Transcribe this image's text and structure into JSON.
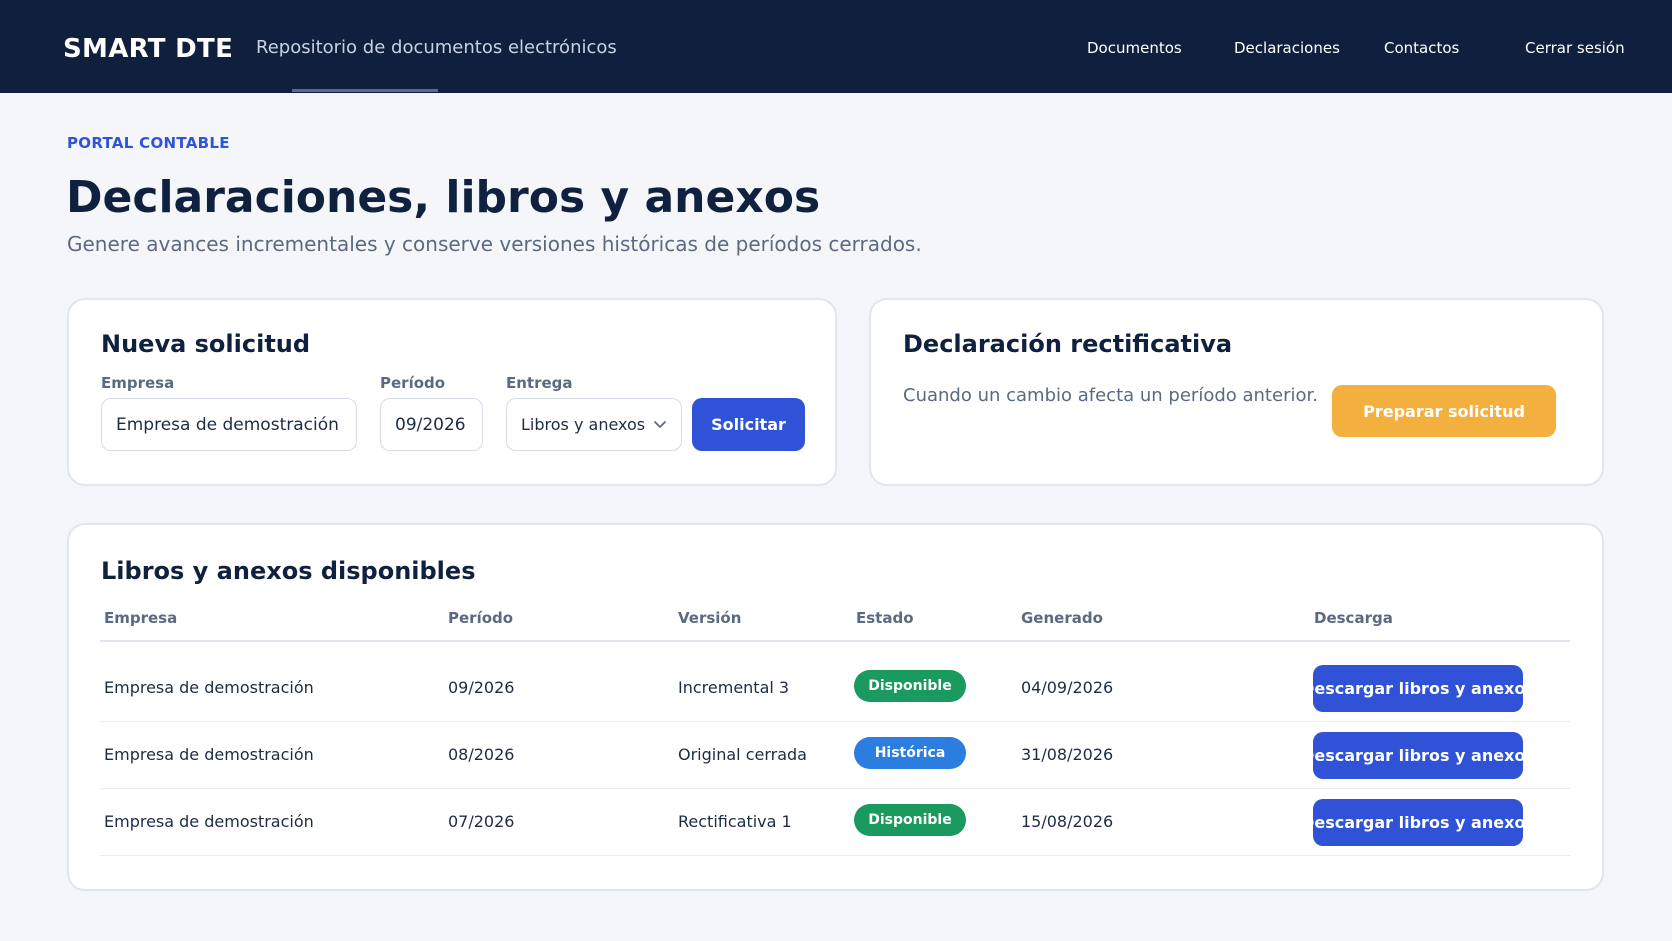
{
  "header": {
    "brand": "SMART DTE",
    "tagline": "Repositorio de documentos electrónicos",
    "nav": [
      "Documentos",
      "Declaraciones",
      "Contactos",
      "Cerrar sesión"
    ]
  },
  "page": {
    "eyebrow": "PORTAL CONTABLE",
    "title": "Declaraciones, libros y anexos",
    "subtitle": "Genere avances incrementales y conserve versiones históricas de períodos cerrados."
  },
  "new_request": {
    "title": "Nueva solicitud",
    "company_label": "Empresa",
    "company_value": "Empresa de demostración",
    "period_label": "Período",
    "period_value": "09/2026",
    "delivery_label": "Entrega",
    "delivery_value": "Libros y anexos",
    "submit_label": "Solicitar"
  },
  "rectification": {
    "title": "Declaración rectificativa",
    "description": "Cuando un cambio afecta un período anterior.",
    "button_label": "Preparar solicitud"
  },
  "table": {
    "title": "Libros y anexos disponibles",
    "headers": [
      "Empresa",
      "Período",
      "Versión",
      "Estado",
      "Generado",
      "Descarga"
    ],
    "rows": [
      {
        "company": "Empresa de demostración",
        "period": "09/2026",
        "version": "Incremental 3",
        "status": "Disponible",
        "generated": "04/09/2026",
        "download": "Descargar libros y anexos"
      },
      {
        "company": "Empresa de demostración",
        "period": "08/2026",
        "version": "Original cerrada",
        "status": "Histórica",
        "generated": "31/08/2026",
        "download": "Descargar libros y anexos"
      },
      {
        "company": "Empresa de demostración",
        "period": "07/2026",
        "version": "Rectificativa 1",
        "status": "Disponible",
        "generated": "15/08/2026",
        "download": "Descargar libros y anexos"
      }
    ]
  },
  "colors": {
    "header_bg": "#0f1f3d",
    "accent": "#2f52d6",
    "amber": "#f4b03f",
    "status_available": "#1a9a5e",
    "status_historic": "#2b7de0"
  },
  "icons": {
    "delivery_dropdown": "chevron-down-icon"
  }
}
